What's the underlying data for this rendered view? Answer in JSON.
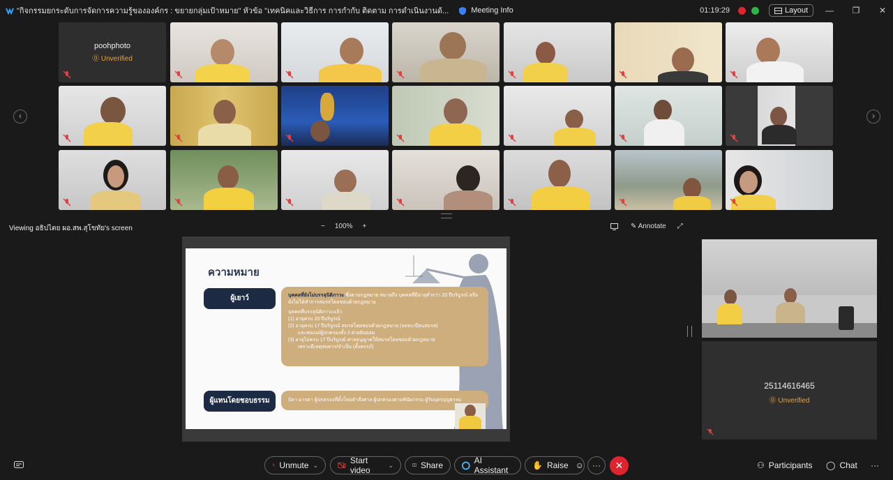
{
  "titlebar": {
    "title": "\"กิจกรรมยกระดับการจัดการความรู้ขององค์กร : ขยายกลุ่มเป้าหมาย\" หัวข้อ \"เทคนิคและวิธีการ การกำกับ ติดตาม การดำเนินงานด้...",
    "meeting_info": "Meeting Info",
    "timer": "01:19:29",
    "layout_label": "Layout",
    "rec_color": "#e0242f",
    "status_color": "#2fb344"
  },
  "grid": {
    "first_tile_name": "poohphoto",
    "first_tile_status": "Unverified"
  },
  "viewbar": {
    "viewing_text": "Viewing อธิปไตย ผอ.สพ.สุโขทัย's screen",
    "zoom_minus": "−",
    "zoom_value": "100%",
    "zoom_plus": "+",
    "annotate_label": "Annotate"
  },
  "slide": {
    "title": "ความหมาย",
    "pill1": "ผู้เยาว์",
    "card1_heading": "บุคคลที่ยังไม่บรรลุนิติภาวะ",
    "card1_text": " ซึ่งตามกฎหมาย หมายถึง บุคคลที่มีอายุต่ำกว่า 20 ปีบริบูรณ์ หรือยังไม่ได้ทำการสมรสโดยชอบด้วยกฎหมาย",
    "card1_sub": "บุคคลที่บรรลุนิติภาวะแล้ว",
    "card1_items": [
      "(1)  อายุครบ 20 ปีบริบูรณ์",
      "(2)  อายุครบ 17 ปีบริบูรณ์ สมรสโดยชอบด้วยกฎหมาย (จดทะเบียนสมรส)",
      "       และพ่อแม่/ผู้ปกครองทั้ง 2 ฝ่ายยินยอม",
      "(3)  อายุไม่ครบ 17 ปีบริบูรณ์ ศาลอนุญาตให้สมรสโดยชอบด้วยกฎหมาย",
      "       เพราะมีเหตุสมควร/จำเป็น (ตั้งครรภ์)"
    ],
    "pill2": "ผู้แทนโดยชอบธรรม",
    "card2_text": "บิดา มารดา ผู้ปกครองที่ตั้งโดยคำสั่งศาล ผู้ปกครองตามพินัยกรรม ผู้รับบุตรบุญธรรม"
  },
  "side": {
    "tile_number": "25114616465",
    "tile_status": "Unverified"
  },
  "toolbar": {
    "unmute": "Unmute",
    "start_video": "Start video",
    "share": "Share",
    "ai_assistant": "AI Assistant",
    "raise": "Raise",
    "participants": "Participants",
    "chat": "Chat",
    "end_color": "#e0242f"
  }
}
